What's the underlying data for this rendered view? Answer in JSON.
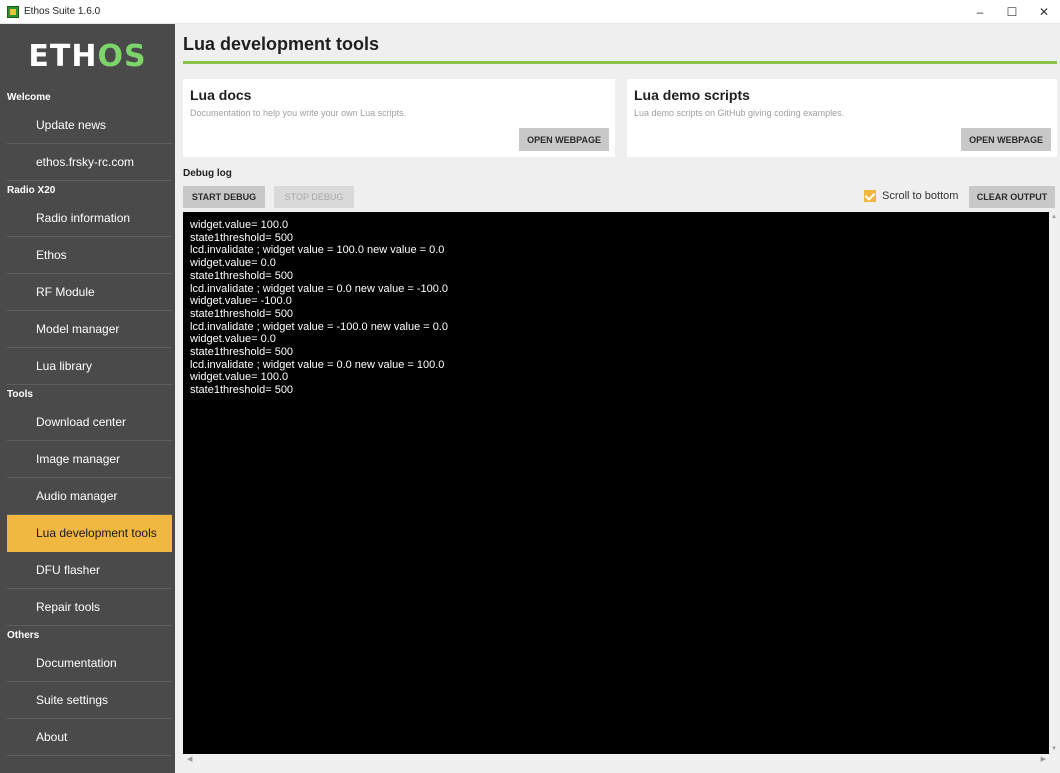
{
  "window": {
    "title": "Ethos Suite 1.6.0",
    "controls": {
      "minimize": "–",
      "maximize": "☐",
      "close": "✕"
    }
  },
  "sidebar": {
    "logo_main": "ETH",
    "logo_accent": "OS",
    "sections": [
      {
        "header": "Welcome",
        "items": [
          "Update news",
          "ethos.frsky-rc.com"
        ]
      },
      {
        "header": "Radio X20",
        "items": [
          "Radio information",
          "Ethos",
          "RF Module",
          "Model manager",
          "Lua library"
        ]
      },
      {
        "header": "Tools",
        "items": [
          "Download center",
          "Image manager",
          "Audio manager",
          "Lua development tools",
          "DFU flasher",
          "Repair tools"
        ]
      },
      {
        "header": "Others",
        "items": [
          "Documentation",
          "Suite settings",
          "About"
        ]
      }
    ],
    "active_item": "Lua development tools"
  },
  "main": {
    "title": "Lua development tools",
    "cards": [
      {
        "title": "Lua docs",
        "description": "Documentation to help you write your own Lua scripts.",
        "button": "OPEN WEBPAGE"
      },
      {
        "title": "Lua demo scripts",
        "description": "Lua demo scripts on GitHub giving coding examples.",
        "button": "OPEN WEBPAGE"
      }
    ],
    "debug": {
      "label": "Debug log",
      "start_button": "START DEBUG",
      "stop_button": "STOP DEBUG",
      "scroll_to_bottom_label": "Scroll to bottom",
      "scroll_to_bottom_checked": true,
      "clear_button": "CLEAR OUTPUT",
      "log_lines": [
        "widget.value= 100.0",
        "state1threshold= 500",
        "lcd.invalidate ; widget value = 100.0 new value = 0.0",
        "widget.value= 0.0",
        "state1threshold= 500",
        "lcd.invalidate ; widget value = 0.0 new value = -100.0",
        "widget.value= -100.0",
        "state1threshold= 500",
        "lcd.invalidate ; widget value = -100.0 new value = 0.0",
        "widget.value= 0.0",
        "state1threshold= 500",
        "lcd.invalidate ; widget value = 0.0 new value = 100.0",
        "widget.value= 100.0",
        "state1threshold= 500"
      ]
    }
  },
  "colors": {
    "sidebar_bg": "#4a4a4a",
    "active_item": "#f0b840",
    "accent_green": "#8bc34a",
    "console_bg": "#000000"
  }
}
